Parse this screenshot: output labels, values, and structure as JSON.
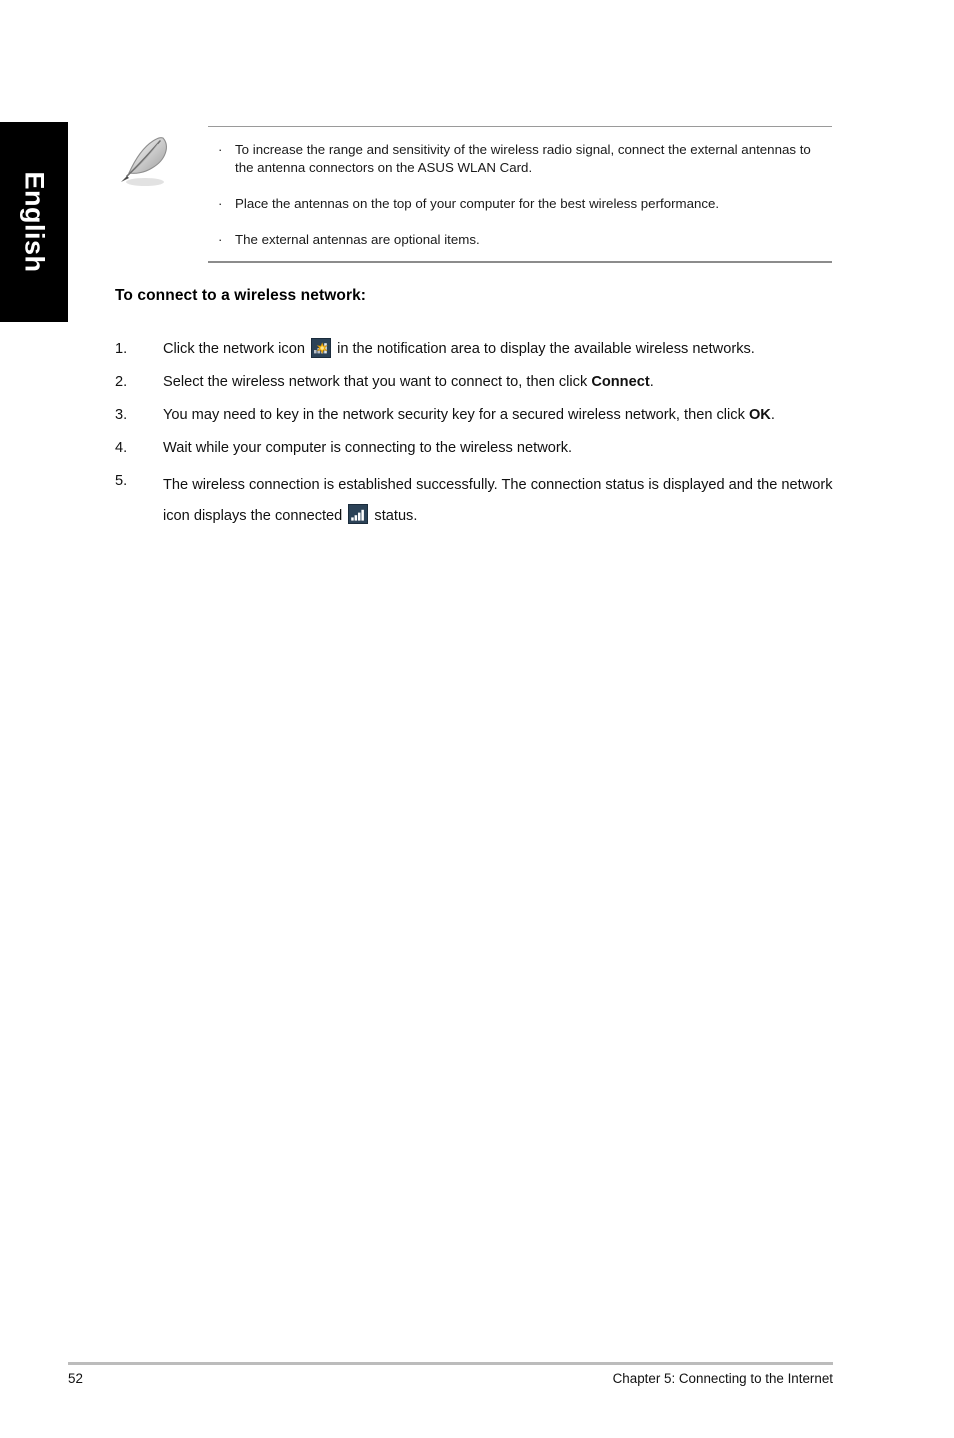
{
  "sidebar": {
    "language_label": "English"
  },
  "note": {
    "icon_name": "note-pen-icon",
    "bullet_char": "·",
    "items": [
      "To increase the range and sensitivity of the wireless radio signal, connect the external antennas to the antenna connectors on the ASUS WLAN Card.",
      "Place the antennas on the top of your computer for the best wireless performance.",
      "The external antennas are optional items."
    ]
  },
  "section": {
    "heading": "To connect to a wireless network:"
  },
  "steps": [
    {
      "number": "1.",
      "part1": "Click the network icon",
      "icon": "wireless-network-available-icon",
      "part2": "in the notification area to display the available wireless networks."
    },
    {
      "number": "2.",
      "part1": "Select the wireless network that you want to connect to, then click",
      "bold": "Connect",
      "part2": "."
    },
    {
      "number": "3.",
      "part1": "You may need to key in the network security key for a secured wireless network, then click",
      "bold": "OK",
      "part2": "."
    },
    {
      "number": "4.",
      "part1": "Wait while your computer is connecting to the wireless network."
    },
    {
      "number": "5.",
      "part1": "The wireless connection is established successfully. The connection status is displayed and the network icon displays the connected",
      "icon": "wireless-connected-signal-icon",
      "part2": "status."
    }
  ],
  "footer": {
    "page_number": "52",
    "chapter": "Chapter 5: Connecting to the Internet"
  },
  "colors": {
    "tab_background": "#000000",
    "tab_text": "#ffffff",
    "icon_chip_background": "#2b4257",
    "rule": "#9a9a9a",
    "footer_rule": "#bcbcbc",
    "starburst": "#f5b617"
  }
}
